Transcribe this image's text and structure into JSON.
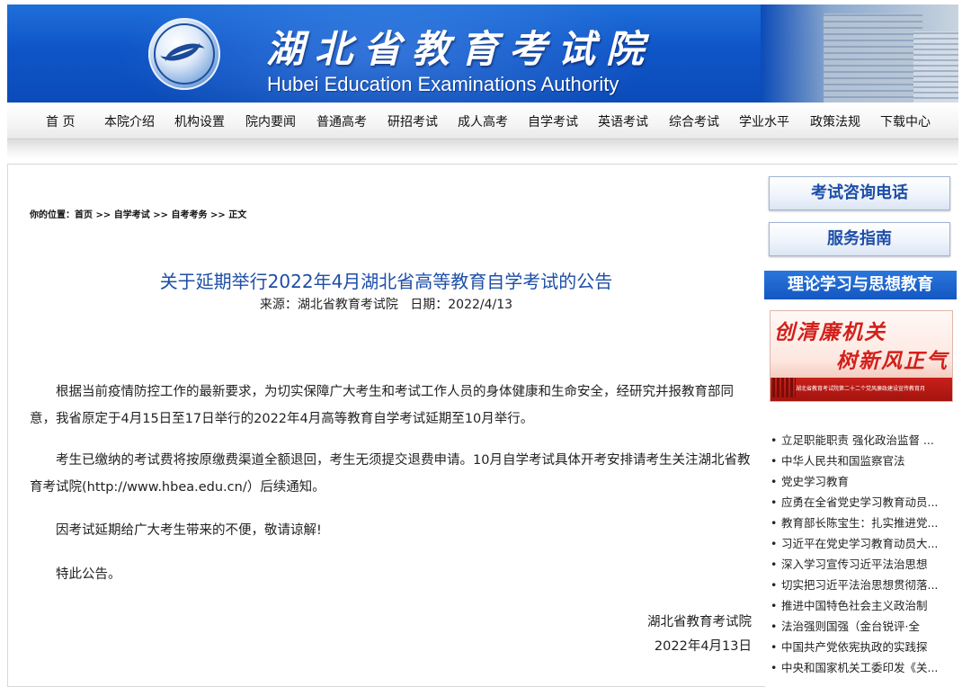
{
  "header": {
    "title_cn": "湖北省教育考试院",
    "title_en": "Hubei Education Examinations Authority",
    "logo_name": "hbea-logo"
  },
  "nav": {
    "items": [
      "首 页",
      "本院介绍",
      "机构设置",
      "院内要闻",
      "普通高考",
      "研招考试",
      "成人高考",
      "自学考试",
      "英语考试",
      "综合考试",
      "学业水平",
      "政策法规",
      "下载中心"
    ]
  },
  "breadcrumb": {
    "prefix": "你的位置：",
    "items": [
      "首页",
      "自学考试",
      "自考考务",
      "正文"
    ],
    "sep": " >> "
  },
  "article": {
    "title": "关于延期举行2022年4月湖北省高等教育自学考试的公告",
    "meta": "来源：湖北省教育考试院   日期：2022/4/13",
    "paragraphs": [
      "根据当前疫情防控工作的最新要求，为切实保障广大考生和考试工作人员的身体健康和生命安全，经研究并报教育部同意，我省原定于4月15日至17日举行的2022年4月高等教育自学考试延期至10月举行。",
      "考生已缴纳的考试费将按原缴费渠道全额退回，考生无须提交退费申请。10月自学考试具体开考安排请考生关注湖北省教育考试院(http://www.hbea.edu.cn/）后续通知。",
      "因考试延期给广大考生带来的不便，敬请谅解!",
      "特此公告。"
    ],
    "sign_org": "湖北省教育考试院",
    "sign_date": "2022年4月13日"
  },
  "sidebar": {
    "hotline": "考试咨询电话",
    "guide": "服务指南",
    "theory_header": "理论学习与思想教育",
    "promo": {
      "line1": "创清廉机关",
      "line2": "树新风正气",
      "caption": "湖北省教育考试院第二十二个党风廉政建设宣传教育月"
    },
    "news": [
      "立足职能职责 强化政治监督 ...",
      "中华人民共和国监察官法",
      "党史学习教育",
      "应勇在全省党史学习教育动员...",
      "教育部长陈宝生：扎实推进党...",
      "习近平在党史学习教育动员大...",
      "深入学习宣传习近平法治思想",
      "切实把习近平法治思想贯彻落...",
      "推进中国特色社会主义政治制",
      "法治强则国强（金台锐评·全",
      "中国共产党依宪执政的实践探",
      "中央和国家机关工委印发《关..."
    ]
  }
}
